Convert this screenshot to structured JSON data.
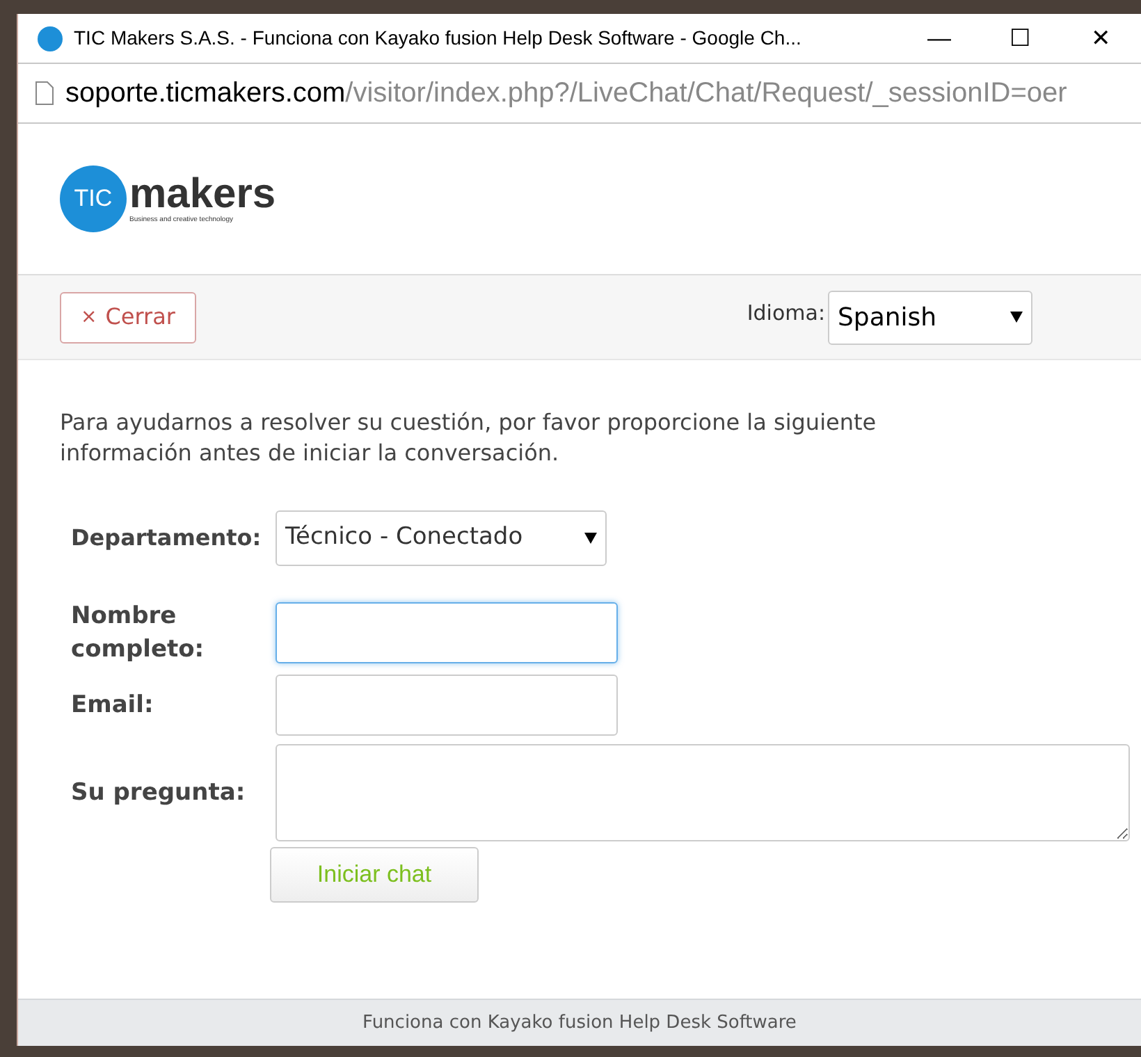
{
  "window": {
    "title": "TIC Makers S.A.S. - Funciona con Kayako fusion Help Desk Software - Google Ch...",
    "controls": [
      "—",
      "☐",
      "✕"
    ]
  },
  "address_bar": {
    "host": "soporte.ticmakers.com",
    "path": "/visitor/index.php?/LiveChat/Chat/Request/_sessionID=oer"
  },
  "logo": {
    "mark": "TIC",
    "name": "makers",
    "tagline": "Business and creative technology"
  },
  "toolbar": {
    "close_button": {
      "icon": "×",
      "label": "Cerrar"
    },
    "language": {
      "label": "Idioma:",
      "value": "Spanish"
    }
  },
  "intro": "Para ayudarnos a resolver su cuestión, por favor proporcione la siguiente información antes de iniciar la conversación.",
  "department": {
    "label": "Departamento:",
    "value": "Técnico - Conectado"
  },
  "fields": [
    {
      "kind": "input",
      "label": "Nombre completo:",
      "focused": true
    },
    {
      "kind": "input",
      "label": "Email:",
      "focused": false
    },
    {
      "kind": "textarea",
      "label": "Su pregunta:",
      "focused": false
    }
  ],
  "submit": "Iniciar chat",
  "footer": "Funciona con Kayako fusion Help Desk Software"
}
